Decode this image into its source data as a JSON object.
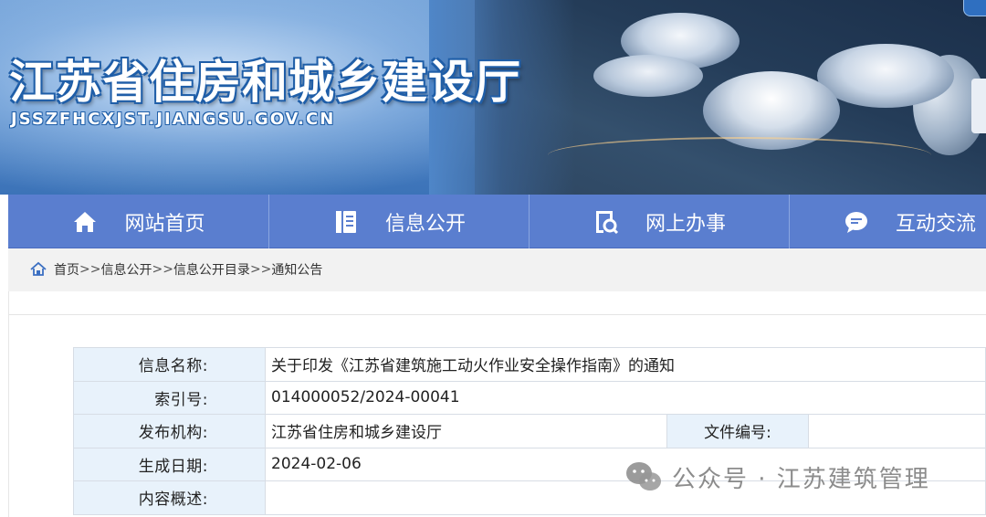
{
  "banner": {
    "site_title": "江苏省住房和城乡建设厅",
    "site_domain": "JSSZFHCXJST.JIANGSU.GOV.CN"
  },
  "nav": {
    "items": [
      {
        "label": "网站首页",
        "icon": "home-icon"
      },
      {
        "label": "信息公开",
        "icon": "document-icon"
      },
      {
        "label": "网上办事",
        "icon": "search-document-icon"
      },
      {
        "label": "互动交流",
        "icon": "chat-icon"
      }
    ]
  },
  "breadcrumb": {
    "items": [
      "首页",
      "信息公开",
      "信息公开目录",
      "通知公告"
    ],
    "separator": ">>"
  },
  "info": {
    "name_label": "信息名称:",
    "name_value": "关于印发《江苏省建筑施工动火作业安全操作指南》的通知",
    "index_label": "索引号:",
    "index_value": "014000052/2024-00041",
    "publisher_label": "发布机构:",
    "publisher_value": "江苏省住房和城乡建设厅",
    "doc_no_label": "文件编号:",
    "doc_no_value": "",
    "date_label": "生成日期:",
    "date_value": "2024-02-06",
    "summary_label": "内容概述:",
    "summary_value": ""
  },
  "watermark": {
    "text": "公众号 · 江苏建筑管理"
  },
  "colors": {
    "nav_bg": "#5a7ecf",
    "label_bg": "#e8f2fb",
    "breadcrumb_bg": "#f2f2f2"
  }
}
